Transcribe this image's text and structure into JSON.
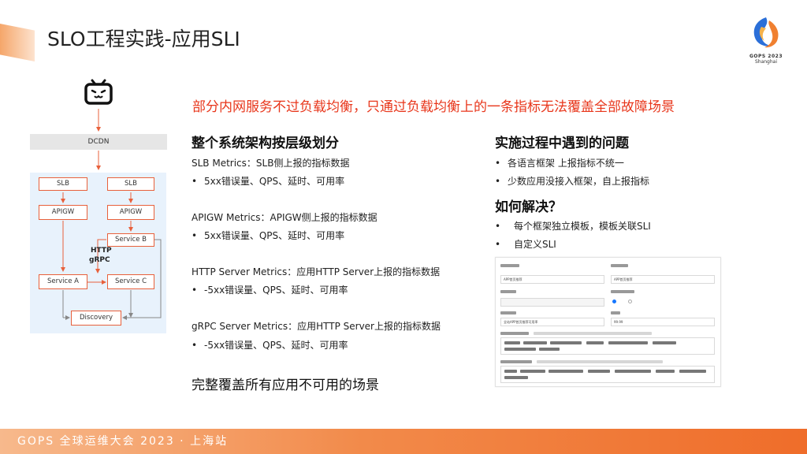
{
  "header": {
    "title": "SLO工程实践-应用SLI",
    "logo_text": "GOPS 2023",
    "logo_city": "Shanghai"
  },
  "subtitle": "部分内网服务不过负载均衡，只通过负载均衡上的一条指标无法覆盖全部故障场景",
  "left_column": {
    "heading": "整个系统架构按层级划分",
    "sections": [
      {
        "title": "SLB Metrics：SLB侧上报的指标数据",
        "bullet": "5xx错误量、QPS、延时、可用率"
      },
      {
        "title": "APIGW Metrics：APIGW侧上报的指标数据",
        "bullet": "5xx错误量、QPS、延时、可用率"
      },
      {
        "title": "HTTP Server Metrics：应用HTTP Server上报的指标数据",
        "bullet": "-5xx错误量、QPS、延时、可用率"
      },
      {
        "title": "gRPC Server Metrics：应用HTTP Server上报的指标数据",
        "bullet": "-5xx错误量、QPS、延时、可用率"
      }
    ],
    "conclusion": "完整覆盖所有应用不可用的场景"
  },
  "right_column": {
    "problems_heading": "实施过程中遇到的问题",
    "problems": [
      "各语言框架 上报指标不统一",
      "少数应用没接入框架，自上报指标"
    ],
    "solution_heading": "如何解决？",
    "solutions": [
      "每个框架独立模板，模板关联SLI",
      "自定义SLI"
    ]
  },
  "bullet_char": "•",
  "diagram": {
    "dcdn": "DCDN",
    "slb1": "SLB",
    "slb2": "SLB",
    "apigw1": "APIGW",
    "apigw2": "APIGW",
    "service_b": "Service B",
    "service_a": "Service A",
    "service_c": "Service C",
    "discovery": "Discovery",
    "protocol_1": "HTTP",
    "protocol_2": "gRPC"
  },
  "form": {
    "value_1": "APP首页推荐",
    "value_2": "APP首页推荐",
    "value_3": "全站APP首页推荐可用率",
    "value_4": "99.99"
  },
  "footer": {
    "text": "GOPS 全球运维大会 2023 · 上海站"
  },
  "colors": {
    "accent_red": "#e8361b",
    "diagram_border": "#e8603b",
    "footer_orange": "#ef6d2a"
  }
}
